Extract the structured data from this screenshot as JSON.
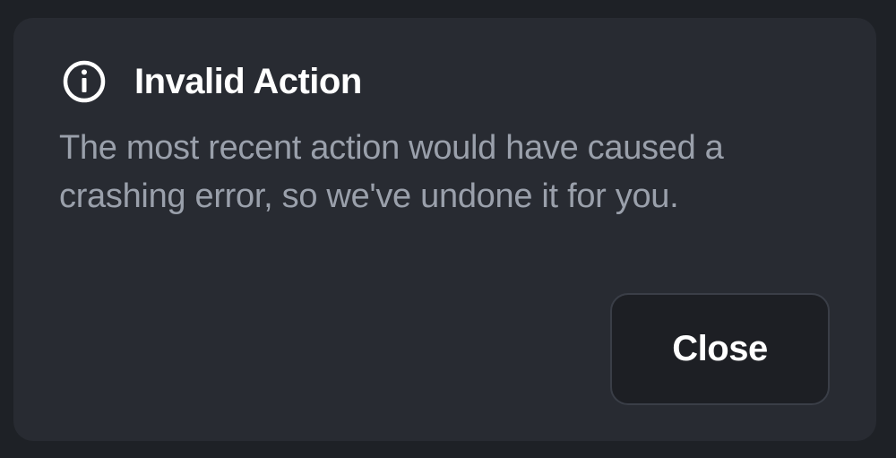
{
  "dialog": {
    "icon": "info-circle-icon",
    "title": "Invalid Action",
    "message": "The most recent action would have caused a crashing error, so we've undone it for you.",
    "close_label": "Close"
  },
  "colors": {
    "page_background": "#1e2126",
    "dialog_background": "#282b32",
    "title_text": "#ffffff",
    "message_text": "#9aa0ab",
    "button_background": "#1d1f24",
    "button_border": "#3a3e47"
  }
}
